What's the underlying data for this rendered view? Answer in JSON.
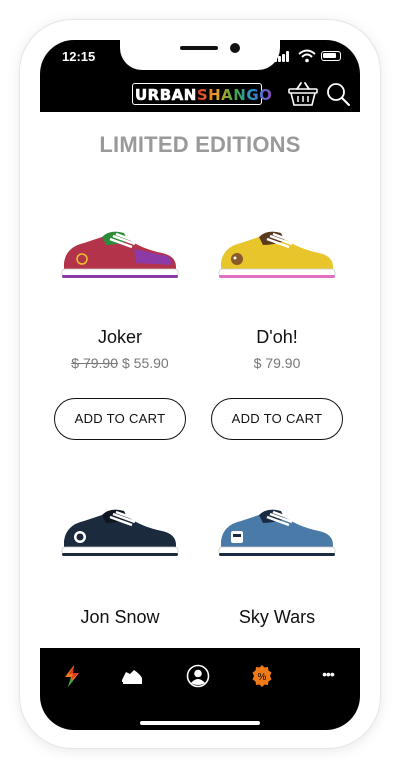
{
  "status_bar": {
    "time": "12:15"
  },
  "header": {
    "logo_part1": "URBAN",
    "logo_part2": "SHANGO",
    "cart_icon": "basket-icon",
    "search_icon": "search-icon"
  },
  "section": {
    "title": "LIMITED EDITIONS"
  },
  "products": [
    {
      "name": "Joker",
      "old_price": "$ 79.90",
      "price": "$ 55.90",
      "button": "ADD TO CART",
      "colors": {
        "upper": "#b3344a",
        "accent": "#2e8b3a",
        "sole": "#ffffff",
        "stripe": "#8b3aa6"
      }
    },
    {
      "name": "D'oh!",
      "old_price": "",
      "price": "$ 79.90",
      "button": "ADD TO CART",
      "colors": {
        "upper": "#e7c52b",
        "accent": "#5a3a1e",
        "sole": "#ffffff",
        "stripe": "#e36fc2"
      }
    },
    {
      "name": "Jon Snow",
      "colors": {
        "upper": "#1c2a3e",
        "accent": "#0e1622",
        "sole": "#ffffff"
      }
    },
    {
      "name": "Sky Wars",
      "colors": {
        "upper": "#4a7aa8",
        "accent": "#1a2c44",
        "sole": "#ffffff"
      }
    }
  ],
  "tabbar": {
    "items": [
      {
        "icon": "lightning-icon"
      },
      {
        "icon": "sneaker-icon"
      },
      {
        "icon": "profile-icon"
      },
      {
        "icon": "discount-badge-icon",
        "label": "%"
      },
      {
        "icon": "more-icon",
        "label": "•••"
      }
    ]
  },
  "theme": {
    "header_bg": "#000000",
    "title_color": "#9a9a9a",
    "accent_orange": "#f07b16"
  }
}
